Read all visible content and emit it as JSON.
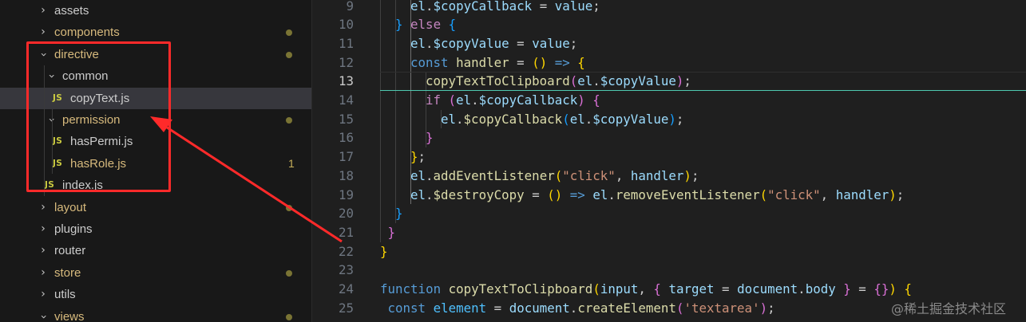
{
  "explorer": {
    "items": [
      {
        "label": "assets",
        "kind": "folder",
        "expanded": false,
        "indent": 1,
        "modified": false
      },
      {
        "label": "components",
        "kind": "folder",
        "expanded": false,
        "indent": 1,
        "modified": true,
        "dot": true
      },
      {
        "label": "directive",
        "kind": "folder",
        "expanded": true,
        "indent": 1,
        "modified": true,
        "dot": true
      },
      {
        "label": "common",
        "kind": "folder",
        "expanded": true,
        "indent": 2,
        "modified": false
      },
      {
        "label": "copyText.js",
        "kind": "js",
        "indent": 3,
        "modified": false,
        "selected": true
      },
      {
        "label": "permission",
        "kind": "folder",
        "expanded": true,
        "indent": 2,
        "modified": true,
        "dot": true
      },
      {
        "label": "hasPermi.js",
        "kind": "js",
        "indent": 3,
        "modified": false
      },
      {
        "label": "hasRole.js",
        "kind": "js",
        "indent": 3,
        "modified": true,
        "count": "1"
      },
      {
        "label": "index.js",
        "kind": "js",
        "indent": 2,
        "modified": false
      },
      {
        "label": "layout",
        "kind": "folder",
        "expanded": false,
        "indent": 1,
        "modified": true,
        "dot": true
      },
      {
        "label": "plugins",
        "kind": "folder",
        "expanded": false,
        "indent": 1,
        "modified": false
      },
      {
        "label": "router",
        "kind": "folder",
        "expanded": false,
        "indent": 1,
        "modified": false
      },
      {
        "label": "store",
        "kind": "folder",
        "expanded": false,
        "indent": 1,
        "modified": true,
        "dot": true
      },
      {
        "label": "utils",
        "kind": "folder",
        "expanded": false,
        "indent": 1,
        "modified": false
      },
      {
        "label": "views",
        "kind": "folder",
        "expanded": true,
        "indent": 1,
        "modified": true,
        "dot": true
      }
    ],
    "js_badge": "JS"
  },
  "editor": {
    "active_line": "13",
    "lines": [
      {
        "n": "9",
        "indent": 2,
        "t": [
          [
            "vr",
            "el"
          ],
          [
            "pl",
            "."
          ],
          [
            "vr",
            "$copyCallback"
          ],
          [
            "pl",
            " = "
          ],
          [
            "vr",
            "value"
          ],
          [
            "pl",
            ";"
          ]
        ]
      },
      {
        "n": "10",
        "indent": 1,
        "t": [
          [
            "b3",
            "}"
          ],
          [
            "pl",
            " "
          ],
          [
            "kc",
            "else"
          ],
          [
            "pl",
            " "
          ],
          [
            "b3",
            "{"
          ]
        ]
      },
      {
        "n": "11",
        "indent": 2,
        "t": [
          [
            "vr",
            "el"
          ],
          [
            "pl",
            "."
          ],
          [
            "vr",
            "$copyValue"
          ],
          [
            "pl",
            " = "
          ],
          [
            "vr",
            "value"
          ],
          [
            "pl",
            ";"
          ]
        ]
      },
      {
        "n": "12",
        "indent": 2,
        "t": [
          [
            "kw",
            "const"
          ],
          [
            "pl",
            " "
          ],
          [
            "fn",
            "handler"
          ],
          [
            "pl",
            " = "
          ],
          [
            "b1",
            "()"
          ],
          [
            "pl",
            " "
          ],
          [
            "kw",
            "=>"
          ],
          [
            "pl",
            " "
          ],
          [
            "b1",
            "{"
          ]
        ]
      },
      {
        "n": "13",
        "indent": 3,
        "t": [
          [
            "fn",
            "copyTextToClipboard"
          ],
          [
            "b2",
            "("
          ],
          [
            "vr",
            "el"
          ],
          [
            "pl",
            "."
          ],
          [
            "vr",
            "$copyValue"
          ],
          [
            "b2",
            ")"
          ],
          [
            "pl",
            ";"
          ]
        ]
      },
      {
        "n": "14",
        "indent": 3,
        "t": [
          [
            "kc",
            "if"
          ],
          [
            "pl",
            " "
          ],
          [
            "b2",
            "("
          ],
          [
            "vr",
            "el"
          ],
          [
            "pl",
            "."
          ],
          [
            "vr",
            "$copyCallback"
          ],
          [
            "b2",
            ")"
          ],
          [
            "pl",
            " "
          ],
          [
            "b2",
            "{"
          ]
        ]
      },
      {
        "n": "15",
        "indent": 4,
        "t": [
          [
            "vr",
            "el"
          ],
          [
            "pl",
            "."
          ],
          [
            "fn",
            "$copyCallback"
          ],
          [
            "b3",
            "("
          ],
          [
            "vr",
            "el"
          ],
          [
            "pl",
            "."
          ],
          [
            "vr",
            "$copyValue"
          ],
          [
            "b3",
            ")"
          ],
          [
            "pl",
            ";"
          ]
        ]
      },
      {
        "n": "16",
        "indent": 3,
        "t": [
          [
            "b2",
            "}"
          ]
        ]
      },
      {
        "n": "17",
        "indent": 2,
        "t": [
          [
            "b1",
            "}"
          ],
          [
            "pl",
            ";"
          ]
        ]
      },
      {
        "n": "18",
        "indent": 2,
        "t": [
          [
            "vr",
            "el"
          ],
          [
            "pl",
            "."
          ],
          [
            "fn",
            "addEventListener"
          ],
          [
            "b1",
            "("
          ],
          [
            "st",
            "\"click\""
          ],
          [
            "pl",
            ", "
          ],
          [
            "vr",
            "handler"
          ],
          [
            "b1",
            ")"
          ],
          [
            "pl",
            ";"
          ]
        ]
      },
      {
        "n": "19",
        "indent": 2,
        "t": [
          [
            "vr",
            "el"
          ],
          [
            "pl",
            "."
          ],
          [
            "fn",
            "$destroyCopy"
          ],
          [
            "pl",
            " = "
          ],
          [
            "b1",
            "()"
          ],
          [
            "pl",
            " "
          ],
          [
            "kw",
            "=>"
          ],
          [
            "pl",
            " "
          ],
          [
            "vr",
            "el"
          ],
          [
            "pl",
            "."
          ],
          [
            "fn",
            "removeEventListener"
          ],
          [
            "b1",
            "("
          ],
          [
            "st",
            "\"click\""
          ],
          [
            "pl",
            ", "
          ],
          [
            "vr",
            "handler"
          ],
          [
            "b1",
            ")"
          ],
          [
            "pl",
            ";"
          ]
        ]
      },
      {
        "n": "20",
        "indent": 1,
        "t": [
          [
            "b3",
            "}"
          ]
        ]
      },
      {
        "n": "21",
        "indent": 0.5,
        "t": [
          [
            "b2",
            "}"
          ]
        ]
      },
      {
        "n": "22",
        "indent": 0,
        "t": [
          [
            "b1",
            "}"
          ]
        ]
      },
      {
        "n": "23",
        "indent": 0,
        "t": []
      },
      {
        "n": "24",
        "indent": 0,
        "t": [
          [
            "kw",
            "function"
          ],
          [
            "pl",
            " "
          ],
          [
            "fn",
            "copyTextToClipboard"
          ],
          [
            "b1",
            "("
          ],
          [
            "vr",
            "input"
          ],
          [
            "pl",
            ", "
          ],
          [
            "b2",
            "{"
          ],
          [
            "pl",
            " "
          ],
          [
            "vr",
            "target"
          ],
          [
            "pl",
            " = "
          ],
          [
            "vr",
            "document"
          ],
          [
            "pl",
            "."
          ],
          [
            "vr",
            "body"
          ],
          [
            "pl",
            " "
          ],
          [
            "b2",
            "}"
          ],
          [
            "pl",
            " = "
          ],
          [
            "b2",
            "{}"
          ],
          [
            "b1",
            ")"
          ],
          [
            "pl",
            " "
          ],
          [
            "b1",
            "{"
          ]
        ]
      },
      {
        "n": "25",
        "indent": 0.5,
        "t": [
          [
            "kw",
            "const"
          ],
          [
            "pl",
            " "
          ],
          [
            "cn",
            "element"
          ],
          [
            "pl",
            " = "
          ],
          [
            "vr",
            "document"
          ],
          [
            "pl",
            "."
          ],
          [
            "fn",
            "createElement"
          ],
          [
            "b2",
            "("
          ],
          [
            "st",
            "'textarea'"
          ],
          [
            "b2",
            ")"
          ],
          [
            "pl",
            ";"
          ]
        ]
      }
    ]
  },
  "watermark": "@稀土掘金技术社区"
}
